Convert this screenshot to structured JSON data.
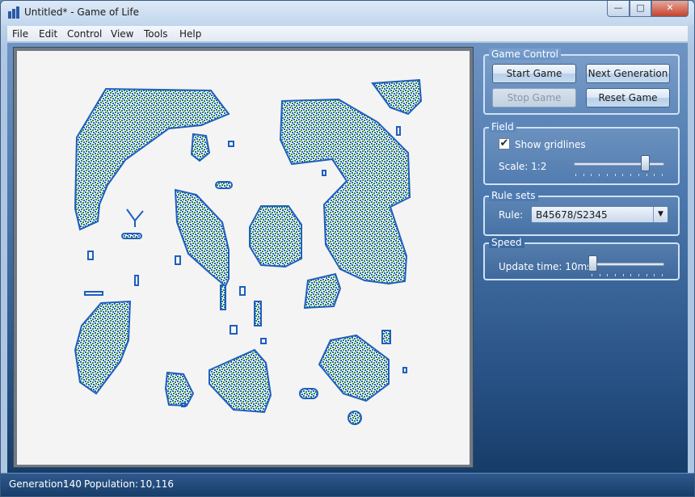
{
  "window": {
    "title": "Untitled* - Game of Life",
    "controls": {
      "minimize": "—",
      "maximize": "□",
      "close": "✕"
    },
    "app_icon": "grid-icon"
  },
  "menu": [
    {
      "label": "File"
    },
    {
      "label": "Edit"
    },
    {
      "label": "Control"
    },
    {
      "label": "View"
    },
    {
      "label": "Tools"
    },
    {
      "label": "Help"
    }
  ],
  "game_control": {
    "legend": "Game Control",
    "start": "Start Game",
    "next": "Next Generation",
    "stop": "Stop Game",
    "reset": "Reset Game"
  },
  "field_group": {
    "legend": "Field",
    "show_gridlines_label": "Show gridlines",
    "show_gridlines_checked": true,
    "check_glyph": "✔",
    "scale_label": "Scale: 1:2",
    "scale_slider_fraction": 0.82
  },
  "rule_sets": {
    "legend": "Rule sets",
    "rule_label": "Rule:",
    "rule_value": "B45678/S2345",
    "arrow_glyph": "▼"
  },
  "speed": {
    "legend": "Speed",
    "update_label": "Update time: 10ms",
    "update_slider_fraction": 0.0
  },
  "status": {
    "generation_label": "Generation:",
    "generation_value": "140",
    "population_label": "Population:",
    "population_value": "10,116"
  },
  "colors": {
    "live_cell_blue": "#1f5fc0",
    "live_cell_green": "#1e8a3a",
    "field_background": "#f4f4f4"
  }
}
